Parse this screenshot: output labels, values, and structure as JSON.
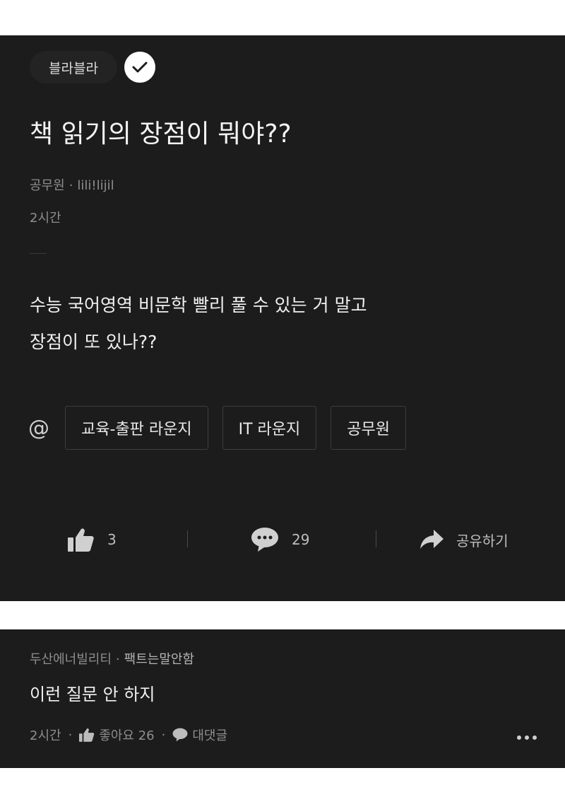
{
  "post": {
    "board": "블라블라",
    "title": "책 읽기의 장점이 뭐야??",
    "author_company": "공무원",
    "author_nick": "lili!lijil",
    "time": "2시간",
    "body_lines": [
      "수능 국어영역 비문학 빨리 풀 수 있는 거 말고",
      "장점이 또 있나??"
    ],
    "tags": [
      "교육-출판 라운지",
      "IT 라운지",
      "공무원"
    ],
    "actions": {
      "like_count": "3",
      "comment_count": "29",
      "share_label": "공유하기"
    }
  },
  "comment": {
    "company": "두산에너빌리티",
    "nick": "팩트는말안함",
    "text": "이런 질문 안 하지",
    "time": "2시간",
    "like_label": "좋아요 26",
    "reply_label": "대댓글"
  },
  "icons": [
    "check-icon",
    "at-icon",
    "thumbs-up-icon",
    "comment-bubble-icon",
    "share-arrow-icon",
    "more-dots-icon"
  ],
  "colors": {
    "card_bg": "#1c1c1c",
    "page_bg": "#ffffff",
    "muted_text": "#8e8e8e"
  }
}
